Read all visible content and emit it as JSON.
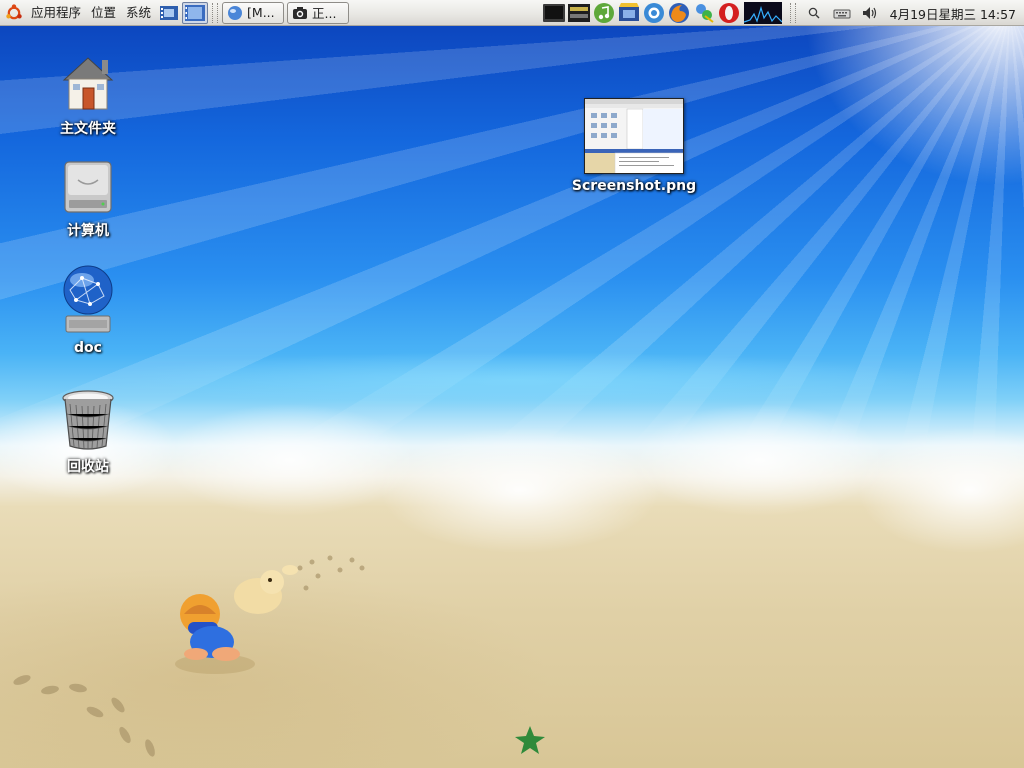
{
  "panel": {
    "menus": [
      "应用程序",
      "位置",
      "系统"
    ],
    "tasks": [
      {
        "label": "[M...",
        "icon": "globe-icon"
      },
      {
        "label": "正...",
        "icon": "camera-icon"
      }
    ],
    "tray_icons": [
      "terminal-icon",
      "unknown-app-icon",
      "music-note-icon",
      "media-player-icon",
      "qq-icon",
      "firefox-icon",
      "messenger-icon",
      "opera-icon"
    ],
    "clock": "4月19日星期三 14:57"
  },
  "desktop": {
    "icons": [
      {
        "label": "主文件夹",
        "icon": "home-folder-icon"
      },
      {
        "label": "计算机",
        "icon": "computer-drive-icon"
      },
      {
        "label": "doc",
        "icon": "network-globe-drive-icon"
      },
      {
        "label": "回收站",
        "icon": "trash-can-icon"
      },
      {
        "label": "Screenshot.png",
        "icon": "image-thumbnail-icon"
      }
    ]
  },
  "colors": {
    "sky_top": "#0b3fb8",
    "sea": "#2a8ff0",
    "sand": "#e0d0a6",
    "panel": "#e9e8e4"
  }
}
